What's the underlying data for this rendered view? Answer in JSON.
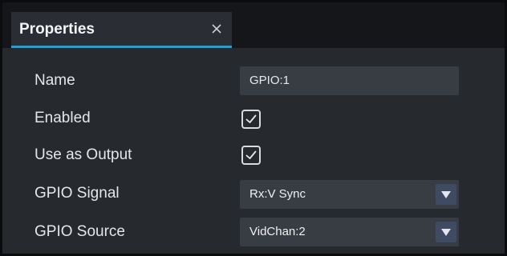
{
  "panel": {
    "title": "Properties",
    "close_icon": "close-icon",
    "accent_color": "#1fa0d6"
  },
  "fields": {
    "name": {
      "label": "Name",
      "value": "GPIO:1"
    },
    "enabled": {
      "label": "Enabled",
      "checked": true
    },
    "use_as_output": {
      "label": "Use as Output",
      "checked": true
    },
    "gpio_signal": {
      "label": "GPIO Signal",
      "value": "Rx:V Sync"
    },
    "gpio_source": {
      "label": "GPIO Source",
      "value": "VidChan:2"
    }
  }
}
